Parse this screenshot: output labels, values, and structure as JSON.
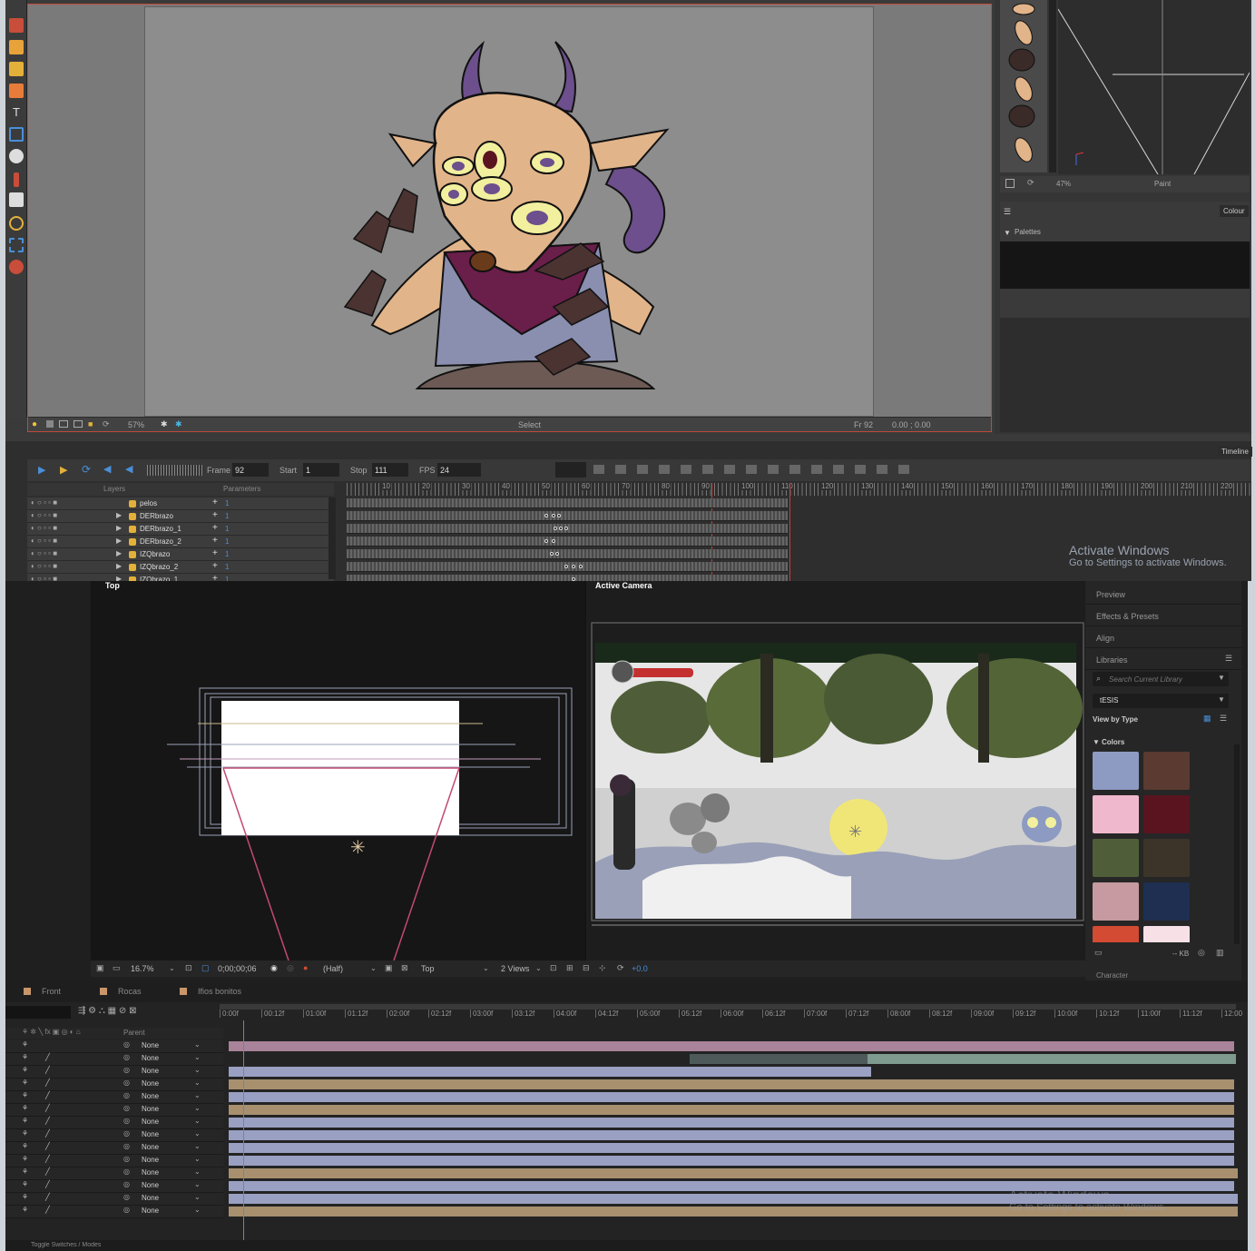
{
  "harmony": {
    "viewport": {
      "zoom": "57%",
      "tool_label": "Select",
      "frame_readout": "Fr 92",
      "coords": "0.00 ; 0.00"
    },
    "side": {
      "zoom": "47%",
      "paint_label": "Paint",
      "colour_tab": "Colour",
      "palettes_label": "Palettes",
      "timeline_tab": "Timeline"
    },
    "playback": {
      "frame_label": "Frame",
      "frame_value": "92",
      "start_label": "Start",
      "start_value": "1",
      "stop_label": "Stop",
      "stop_value": "111",
      "fps_label": "FPS",
      "fps_value": "24"
    },
    "layers_header": "Layers",
    "parameters_header": "Parameters",
    "ruler": [
      "10",
      "20",
      "30",
      "40",
      "50",
      "60",
      "70",
      "80",
      "90",
      "100",
      "110",
      "120",
      "130",
      "140",
      "150",
      "160",
      "170",
      "180",
      "190",
      "200",
      "210",
      "220"
    ],
    "layers": [
      {
        "name": "pelos",
        "value": "1"
      },
      {
        "name": "DERbrazo",
        "value": "1"
      },
      {
        "name": "DERbrazo_1",
        "value": "1"
      },
      {
        "name": "DERbrazo_2",
        "value": "1"
      },
      {
        "name": "IZQbrazo",
        "value": "1"
      },
      {
        "name": "IZQbrazo_2",
        "value": "1"
      },
      {
        "name": "IZQbrazo_1",
        "value": "1"
      }
    ],
    "watermark": {
      "title": "Activate Windows",
      "subtitle": "Go to Settings to activate Windows."
    }
  },
  "ae": {
    "top_view_label": "Top",
    "camera_view_label": "Active Camera",
    "side": {
      "items": [
        "Preview",
        "Effects & Presets",
        "Align",
        "Libraries"
      ],
      "search_placeholder": "Search Current Library",
      "library": "tESIS",
      "view_by": "View by Type",
      "colors_label": "Colors",
      "size": "-- KB",
      "next_label": "Character"
    },
    "colors": [
      "#8d9ac2",
      "#5a3a31",
      "#f0b8cc",
      "#5a1420",
      "#4f5e38",
      "#3c3428",
      "#c69aa0",
      "#1e2f52",
      "#d44b33",
      "#f7e1e6"
    ],
    "bar": {
      "zoom": "16.7%",
      "time": "0;00;00;06",
      "resolution": "(Half)",
      "view": "Top",
      "views": "2 Views",
      "exposure": "+0.0"
    },
    "tabs": [
      "Front",
      "Rocas",
      "Ifios bonitos"
    ],
    "timecodes": [
      "0:00f",
      "00:12f",
      "01:00f",
      "01:12f",
      "02:00f",
      "02:12f",
      "03:00f",
      "03:12f",
      "04:00f",
      "04:12f",
      "05:00f",
      "05:12f",
      "06:00f",
      "06:12f",
      "07:00f",
      "07:12f",
      "08:00f",
      "08:12f",
      "09:00f",
      "09:12f",
      "10:00f",
      "10:12f",
      "11:00f",
      "11:12f",
      "12:00"
    ],
    "parent_header": "Parent",
    "parent_value": "None",
    "footer": "Toggle Switches / Modes",
    "watermark": {
      "title": "Activate Windows",
      "subtitle": "Go to Settings to activate Windows."
    }
  }
}
